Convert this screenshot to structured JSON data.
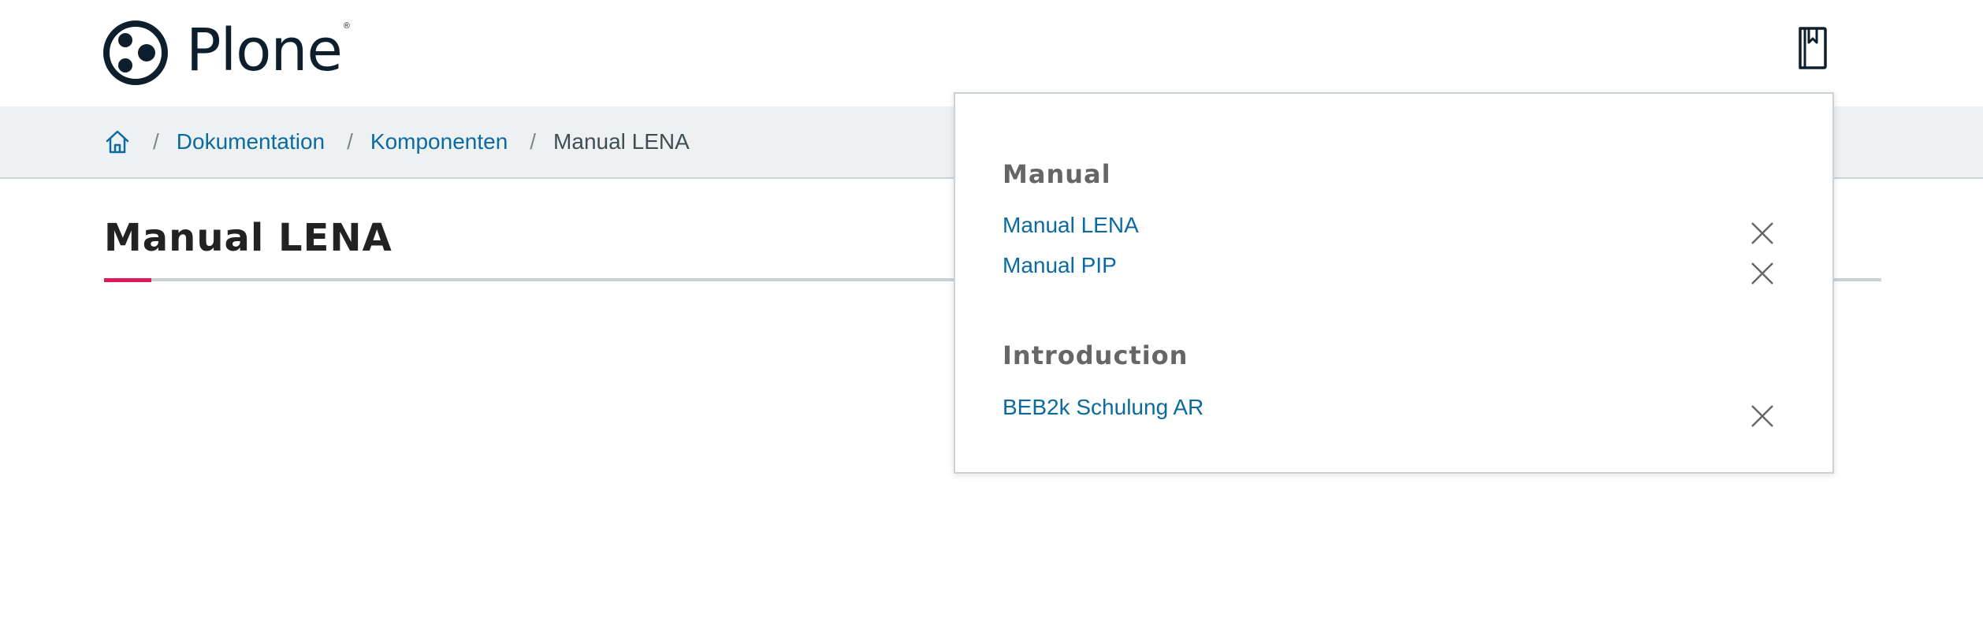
{
  "header": {
    "logo_text": "Plone",
    "logo_reg": "®",
    "bookmark_icon": "bookmark-icon"
  },
  "breadcrumb": {
    "home_icon": "home-icon",
    "separator": "/",
    "items": [
      {
        "label": "Dokumentation"
      },
      {
        "label": "Komponenten"
      }
    ],
    "current": "Manual LENA"
  },
  "main": {
    "title": "Manual LENA"
  },
  "colors": {
    "link": "#0b6aa0",
    "accent": "#e0185a",
    "breadcrumb_bg": "#edf1f2",
    "logo": "#0d1f2d"
  },
  "bookmarks": {
    "groups": [
      {
        "heading": "Manual",
        "items": [
          {
            "label": "Manual LENA"
          },
          {
            "label": "Manual PIP"
          }
        ]
      },
      {
        "heading": "Introduction",
        "items": [
          {
            "label": "BEB2k Schulung AR"
          }
        ]
      }
    ],
    "remove_icon": "close-icon"
  }
}
